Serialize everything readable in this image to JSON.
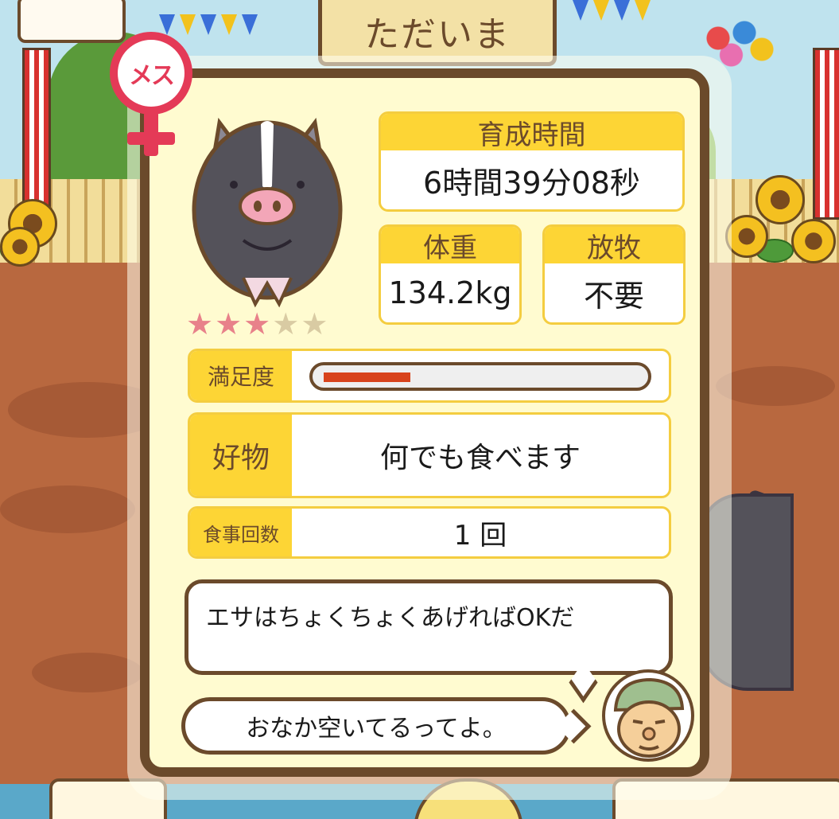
{
  "screen_title": "ただいま",
  "gender_label": "メス",
  "rating": {
    "value": 3,
    "max": 5
  },
  "stars": [
    "★",
    "★",
    "★",
    "★",
    "★"
  ],
  "growth_time": {
    "label": "育成時間",
    "value": "6時間39分08秒"
  },
  "weight": {
    "label": "体重",
    "value": "134.2kg"
  },
  "grazing": {
    "label": "放牧",
    "value": "不要"
  },
  "satisfaction": {
    "label": "満足度",
    "level": 0.27
  },
  "favorite_food": {
    "label": "好物",
    "value": "何でも食べます"
  },
  "meal_count": {
    "label": "食事回数",
    "value": "1 回"
  },
  "speech": {
    "main": "エサはちょくちょくあげればOKだ",
    "hint": "おなか空いてるってよ。"
  },
  "icons": {
    "gender": "female-symbol-icon",
    "pig": "pig-icon",
    "farmer": "farmer-icon",
    "star": "star-icon"
  },
  "colors": {
    "panel_bg": "#fffbd0",
    "panel_border": "#6b4a2b",
    "label_bg": "#fdd535",
    "gender": "#e43a57",
    "star_on": "#e8818a",
    "star_off": "#d9cba3",
    "satisfaction_fill": "#d8431c"
  }
}
